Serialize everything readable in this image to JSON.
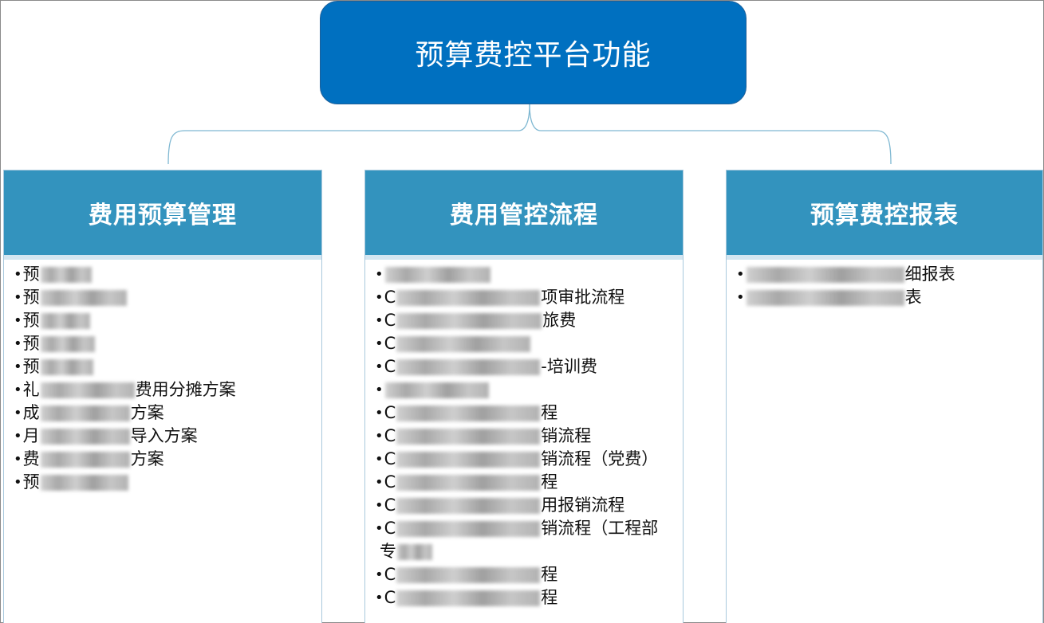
{
  "root": {
    "title": "预算费控平台功能"
  },
  "columns": [
    {
      "title": "费用预算管理",
      "items": [
        {
          "prefix": "预",
          "suffix": ""
        },
        {
          "prefix": "预",
          "suffix": ""
        },
        {
          "prefix": "预",
          "suffix": ""
        },
        {
          "prefix": "预",
          "suffix": ""
        },
        {
          "prefix": "预",
          "suffix": ""
        },
        {
          "prefix": "礼",
          "suffix": "费用分摊方案"
        },
        {
          "prefix": "成",
          "suffix": "方案"
        },
        {
          "prefix": "月",
          "suffix": "导入方案"
        },
        {
          "prefix": "费",
          "suffix": "方案"
        },
        {
          "prefix": "预",
          "suffix": ""
        }
      ]
    },
    {
      "title": "费用管控流程",
      "items": [
        {
          "prefix": "",
          "suffix": ""
        },
        {
          "prefix": "C",
          "suffix": "项审批流程"
        },
        {
          "prefix": "C",
          "suffix": "旅费"
        },
        {
          "prefix": "C",
          "suffix": ""
        },
        {
          "prefix": "C",
          "suffix": "-培训费"
        },
        {
          "prefix": "",
          "suffix": ""
        },
        {
          "prefix": "C",
          "suffix": "程"
        },
        {
          "prefix": "C",
          "suffix": "销流程"
        },
        {
          "prefix": "C",
          "suffix": "销流程（党费）"
        },
        {
          "prefix": "C",
          "suffix": "程"
        },
        {
          "prefix": "C",
          "suffix": "用报销流程"
        },
        {
          "prefix": "C",
          "suffix": "销流程（工程部",
          "line2": "专"
        },
        {
          "prefix": "C",
          "suffix": "程"
        },
        {
          "prefix": "C",
          "suffix": "程"
        }
      ]
    },
    {
      "title": "预算费控报表",
      "items": [
        {
          "prefix": "",
          "suffix": "细报表"
        },
        {
          "prefix": "",
          "suffix": "表"
        }
      ]
    }
  ]
}
